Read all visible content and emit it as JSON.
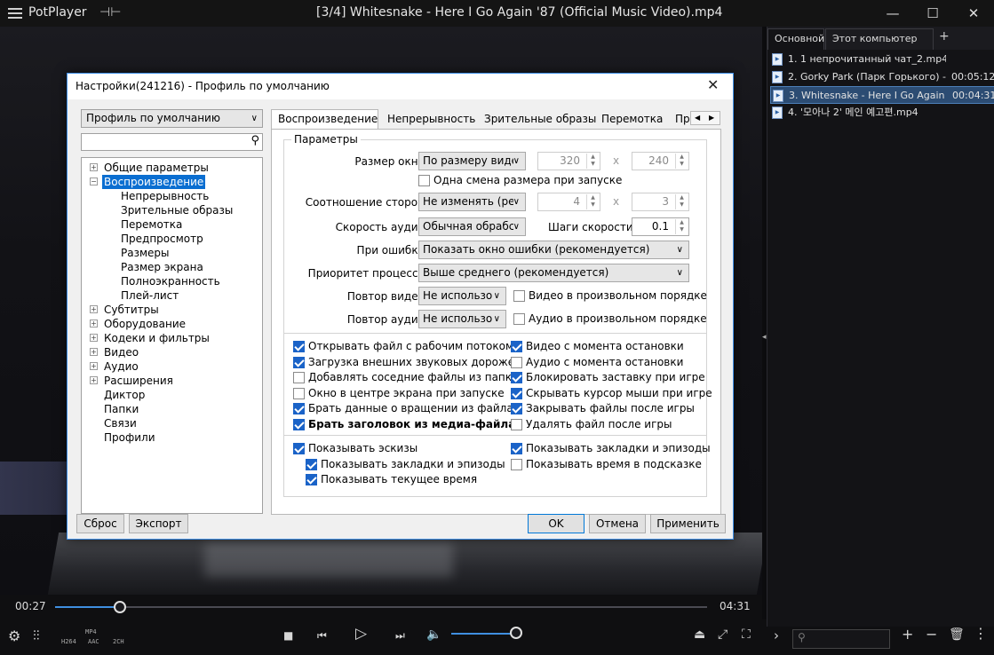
{
  "player": {
    "app_name": "PotPlayer",
    "file_title": "[3/4] Whitesnake - Here I Go Again '87 (Official Music Video).mp4",
    "time_current": "00:27",
    "time_total": "04:31",
    "progress_fraction": 0.1,
    "volume_fraction": 1.0,
    "codec": {
      "container": "MP4",
      "video": "H264",
      "audio": "AAC",
      "channels": "2CH"
    }
  },
  "playlist": {
    "tabs": [
      "Основной",
      "Этот компьютер"
    ],
    "add_label": "+",
    "items": [
      {
        "name": "1. 1 непрочитанный чат_2.mp4",
        "duration": ""
      },
      {
        "name": "2. Gorky Park (Парк Горького) - M...",
        "duration": "00:05:12"
      },
      {
        "name": "3. Whitesnake - Here I Go Again '8...",
        "duration": "00:04:31"
      },
      {
        "name": "4. '모아나 2' 메인 예고편.mp4",
        "duration": ""
      }
    ]
  },
  "dialog": {
    "title": "Настройки(241216) - Профиль по умолчанию",
    "profile": "Профиль по умолчанию",
    "tree": [
      {
        "label": "Общие параметры",
        "expander": "+",
        "level": 0
      },
      {
        "label": "Воспроизведение",
        "expander": "−",
        "level": 0,
        "selected": true
      },
      {
        "label": "Непрерывность",
        "level": 1
      },
      {
        "label": "Зрительные образы",
        "level": 1
      },
      {
        "label": "Перемотка",
        "level": 1
      },
      {
        "label": "Предпросмотр",
        "level": 1
      },
      {
        "label": "Размеры",
        "level": 1
      },
      {
        "label": "Размер экрана",
        "level": 1
      },
      {
        "label": "Полноэкранность",
        "level": 1
      },
      {
        "label": "Плей-лист",
        "level": 1
      },
      {
        "label": "Субтитры",
        "expander": "+",
        "level": 0
      },
      {
        "label": "Оборудование",
        "expander": "+",
        "level": 0
      },
      {
        "label": "Кодеки и фильтры",
        "expander": "+",
        "level": 0
      },
      {
        "label": "Видео",
        "expander": "+",
        "level": 0
      },
      {
        "label": "Аудио",
        "expander": "+",
        "level": 0
      },
      {
        "label": "Расширения",
        "expander": "+",
        "level": 0
      },
      {
        "label": "Диктор",
        "level": 0
      },
      {
        "label": "Папки",
        "level": 0
      },
      {
        "label": "Связи",
        "level": 0
      },
      {
        "label": "Профили",
        "level": 0
      }
    ],
    "tabs": [
      "Воспроизведение",
      "Непрерывность",
      "Зрительные образы",
      "Перемотка",
      "Пр"
    ],
    "group_title": "Параметры",
    "window_size": {
      "label": "Размер окна:",
      "value": "По размеру виде",
      "width": "320",
      "height": "240",
      "x": "x"
    },
    "resize_once": "Одна смена размера при запуске",
    "aspect": {
      "label": "Соотношение сторон:",
      "value": "Не изменять (ре",
      "w": "4",
      "h": "3",
      "x": "x"
    },
    "audio_speed": {
      "label": "Скорость аудио:",
      "value": "Обычная обрабс",
      "step_label": "Шаги скорости:",
      "step_value": "0.1"
    },
    "on_error": {
      "label": "При ошибке:",
      "value": "Показать окно ошибки (рекомендуется)"
    },
    "priority": {
      "label": "Приоритет процесса:",
      "value": "Выше среднего (рекомендуется)"
    },
    "repeat_video": {
      "label": "Повтор видео:",
      "value": "Не использо",
      "random": "Видео в произвольном порядке"
    },
    "repeat_audio": {
      "label": "Повтор аудио:",
      "value": "Не использо",
      "random": "Аудио в произвольном порядке"
    },
    "checks_left": [
      {
        "label": "Открывать файл с рабочим потоком",
        "checked": true
      },
      {
        "label": "Загрузка внешних звуковых дорожек",
        "checked": true
      },
      {
        "label": "Добавлять соседние файлы из папки",
        "checked": false
      },
      {
        "label": "Окно в центре экрана при запуске",
        "checked": false
      },
      {
        "label": "Брать данные о вращении из файла",
        "checked": true
      },
      {
        "label": "Брать заголовок из медиа-файла",
        "checked": true,
        "bold": true
      }
    ],
    "checks_right": [
      {
        "label": "Видео с момента остановки",
        "checked": true
      },
      {
        "label": "Аудио с момента остановки",
        "checked": false
      },
      {
        "label": "Блокировать заставку при игре",
        "checked": true
      },
      {
        "label": "Скрывать курсор мыши при игре",
        "checked": true
      },
      {
        "label": "Закрывать файлы после игры",
        "checked": true
      },
      {
        "label": "Удалять файл после игры",
        "checked": false
      }
    ],
    "thumbs": [
      {
        "label": "Показывать эскизы",
        "checked": true
      },
      {
        "label": "Показывать закладки и эпизоды",
        "checked": true
      },
      {
        "label": "Показывать текущее время",
        "checked": true
      }
    ],
    "thumbs_right": [
      {
        "label": "Показывать закладки и эпизоды",
        "checked": true
      },
      {
        "label": "Показывать время в подсказке",
        "checked": false
      }
    ],
    "buttons": {
      "reset": "Сброс",
      "export": "Экспорт",
      "ok": "OK",
      "cancel": "Отмена",
      "apply": "Применить"
    }
  }
}
